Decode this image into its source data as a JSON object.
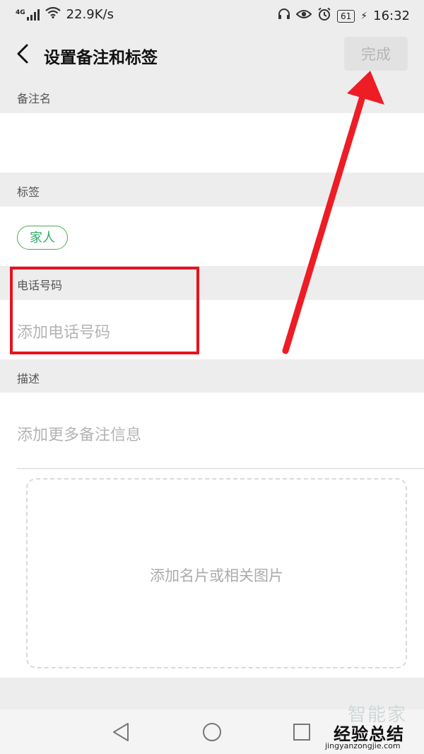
{
  "status_bar": {
    "network": "4G",
    "speed": "22.9K/s",
    "battery": "61",
    "time": "16:32",
    "icons": [
      "signal-icon",
      "wifi-icon",
      "headphones-icon",
      "eye-icon",
      "alarm-icon",
      "battery-icon",
      "charging-icon"
    ]
  },
  "header": {
    "title": "设置备注和标签",
    "done_label": "完成"
  },
  "remark": {
    "label": "备注名",
    "value": ""
  },
  "tags": {
    "label": "标签",
    "items": [
      "家人"
    ]
  },
  "phone": {
    "label": "电话号码",
    "placeholder": "添加电话号码"
  },
  "description": {
    "label": "描述",
    "placeholder": "添加更多备注信息",
    "image_placeholder": "添加名片或相关图片"
  },
  "watermark": {
    "faint": "智能家",
    "main": "经验总结",
    "url": "jingyanzongjie.com"
  },
  "colors": {
    "accent_green": "#2aae67",
    "annotation_red": "#e8121b",
    "background": "#ededed"
  }
}
